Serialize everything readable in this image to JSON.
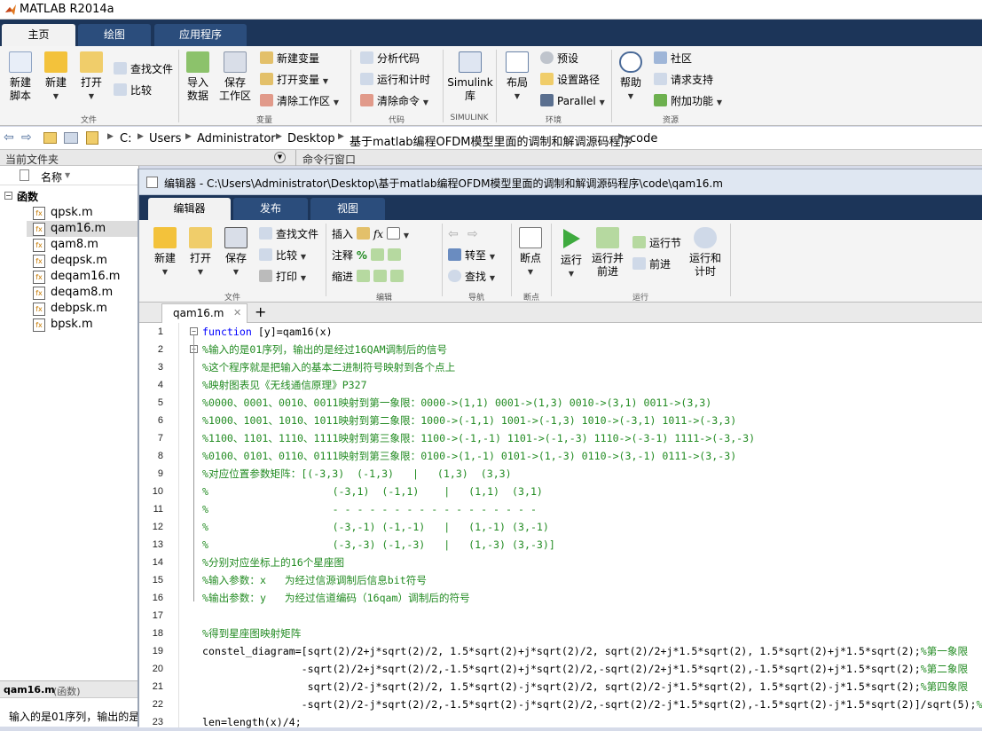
{
  "window": {
    "title": "MATLAB R2014a"
  },
  "main_tabs": [
    "主页",
    "绘图",
    "应用程序"
  ],
  "ribbon": {
    "new_script": "新建\n脚本",
    "new": "新建",
    "open": "打开",
    "find_files": "查找文件",
    "compare": "比较",
    "group_file": "文件",
    "import": "导入\n数据",
    "save_ws": "保存\n工作区",
    "new_var": "新建变量",
    "open_var": "打开变量",
    "clear_ws": "清除工作区",
    "group_var": "变量",
    "analyze": "分析代码",
    "run_time": "运行和计时",
    "clear_cmd": "清除命令",
    "group_code": "代码",
    "simulink": "Simulink\n库",
    "group_simulink": "SIMULINK",
    "layout": "布局",
    "prefs": "预设",
    "set_path": "设置路径",
    "parallel": "Parallel",
    "group_env": "环境",
    "help": "帮助",
    "community": "社区",
    "request_support": "请求支持",
    "addons": "附加功能",
    "group_res": "资源"
  },
  "address": {
    "segments": [
      "C:",
      "Users",
      "Administrator",
      "Desktop",
      "基于matlab编程OFDM模型里面的调制和解调源码程序",
      "code"
    ]
  },
  "panes": {
    "current_folder": "当前文件夹",
    "command_window": "命令行窗口",
    "col_name": "名称"
  },
  "file_browser": {
    "group": "函数",
    "files": [
      "qpsk.m",
      "qam16.m",
      "qam8.m",
      "deqpsk.m",
      "deqam16.m",
      "deqam8.m",
      "debpsk.m",
      "bpsk.m"
    ],
    "selected": "qam16.m",
    "details_title": "qam16.m",
    "details_type": "(函数)",
    "details_text": "输入的是01序列，输出的是"
  },
  "editor": {
    "title": "编辑器 - C:\\Users\\Administrator\\Desktop\\基于matlab编程OFDM模型里面的调制和解调源码程序\\code\\qam16.m",
    "tabs": [
      "编辑器",
      "发布",
      "视图"
    ],
    "ribbon": {
      "new": "新建",
      "open": "打开",
      "save": "保存",
      "find_files": "查找文件",
      "compare": "比较",
      "print": "打印",
      "group_file": "文件",
      "insert": "插入",
      "comment": "注释",
      "indent": "缩进",
      "group_edit": "编辑",
      "goto": "转至",
      "find": "查找",
      "group_nav": "导航",
      "breakpoints": "断点",
      "group_bp": "断点",
      "run": "运行",
      "run_advance": "运行并\n前进",
      "run_section": "运行节",
      "advance": "前进",
      "run_time": "运行和\n计时",
      "group_run": "运行"
    },
    "file_tab": "qam16.m",
    "lines": [
      "function [y]=qam16(x)",
      "%输入的是01序列，输出的是经过16QAM调制后的信号",
      "%这个程序就是把输入的基本二进制符号映射到各个点上",
      "%映射图表见《无线通信原理》P327",
      "%0000、0001、0010、0011映射到第一象限：0000->(1,1) 0001->(1,3) 0010->(3,1) 0011->(3,3)",
      "%1000、1001、1010、1011映射到第二象限：1000->(-1,1) 1001->(-1,3) 1010->(-3,1) 1011->(-3,3)",
      "%1100、1101、1110、1111映射到第三象限：1100->(-1,-1) 1101->(-1,-3) 1110->(-3-1) 1111->(-3,-3)",
      "%0100、0101、0110、0111映射到第三象限：0100->(1,-1) 0101->(1,-3) 0110->(3,-1) 0111->(3,-3)",
      "%对应位置参数矩阵：[(-3,3)  (-1,3)   |   (1,3)  (3,3)",
      "%                    (-3,1)  (-1,1)    |   (1,1)  (3,1)",
      "%                    - - - - - - - - - - - - - - - - -",
      "%                    (-3,-1) (-1,-1)   |   (1,-1) (3,-1)",
      "%                    (-3,-3) (-1,-3)   |   (1,-3) (3,-3)]",
      "%分别对应坐标上的16个星座图",
      "%输入参数：x   为经过信源调制后信息bit符号",
      "%输出参数：y   为经过信道编码（16qam）调制后的符号",
      "",
      "%得到星座图映射矩阵",
      "constel_diagram=[sqrt(2)/2+j*sqrt(2)/2, 1.5*sqrt(2)+j*sqrt(2)/2, sqrt(2)/2+j*1.5*sqrt(2), 1.5*sqrt(2)+j*1.5*sqrt(2);%第一象限",
      "                -sqrt(2)/2+j*sqrt(2)/2,-1.5*sqrt(2)+j*sqrt(2)/2,-sqrt(2)/2+j*1.5*sqrt(2),-1.5*sqrt(2)+j*1.5*sqrt(2);%第二象限",
      "                 sqrt(2)/2-j*sqrt(2)/2, 1.5*sqrt(2)-j*sqrt(2)/2, sqrt(2)/2-j*1.5*sqrt(2), 1.5*sqrt(2)-j*1.5*sqrt(2);%第四象限",
      "                -sqrt(2)/2-j*sqrt(2)/2,-1.5*sqrt(2)-j*sqrt(2)/2,-sqrt(2)/2-j*1.5*sqrt(2),-1.5*sqrt(2)-j*1.5*sqrt(2)]/sqrt(5);%",
      "len=length(x)/4;"
    ]
  },
  "colors": {
    "titlebar_dark": "#1c3559",
    "comment": "#228b22",
    "keyword": "#0000ff",
    "selected_row": "#dcdcdc"
  }
}
